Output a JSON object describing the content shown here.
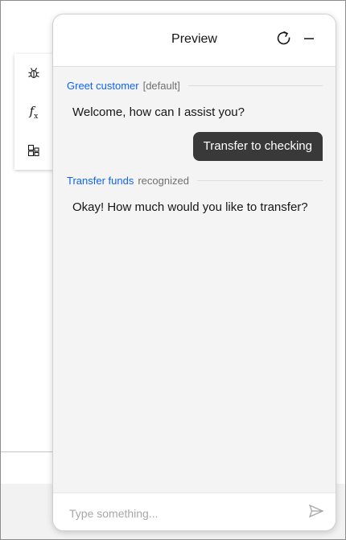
{
  "toolbar": {
    "items": [
      {
        "icon": "debug-icon"
      },
      {
        "icon": "function-icon",
        "label": "f",
        "sub": "x"
      },
      {
        "icon": "variables-icon"
      }
    ]
  },
  "preview": {
    "title": "Preview",
    "refresh_icon": "refresh-icon",
    "minimize_icon": "minimize-icon"
  },
  "conversation": {
    "intents": [
      {
        "name": "Greet customer",
        "status": "[default]"
      },
      {
        "name": "Transfer funds",
        "status": "recognized"
      }
    ],
    "bot_messages": [
      "Welcome, how can I assist you?",
      "Okay! How much would you like to transfer?"
    ],
    "user_messages": [
      "Transfer to checking"
    ]
  },
  "input": {
    "placeholder": "Type something...",
    "value": "",
    "send_icon": "send-icon"
  },
  "colors": {
    "accent": "#0f62fe",
    "user_bubble": "#393939",
    "panel_bg": "#f4f4f4"
  }
}
